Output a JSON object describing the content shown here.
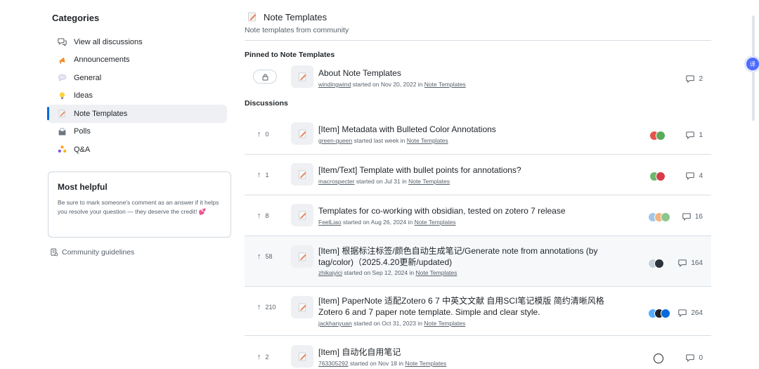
{
  "sidebar": {
    "heading": "Categories",
    "items": [
      {
        "label": "View all discussions",
        "icon": "discussions-icon"
      },
      {
        "label": "Announcements",
        "icon": "megaphone-icon"
      },
      {
        "label": "General",
        "icon": "speech-bubble-icon"
      },
      {
        "label": "Ideas",
        "icon": "lightbulb-icon"
      },
      {
        "label": "Note Templates",
        "icon": "memo-icon",
        "active": true
      },
      {
        "label": "Polls",
        "icon": "ballot-box-icon"
      },
      {
        "label": "Q&A",
        "icon": "people-icon"
      }
    ],
    "helpful": {
      "title": "Most helpful",
      "text": "Be sure to mark someone's comment as an answer if it helps you resolve your question — they deserve the credit! 💕"
    },
    "guidelines": "Community guidelines"
  },
  "header": {
    "title": "Note Templates",
    "subtitle": "Note templates from community"
  },
  "pinned_heading": "Pinned to Note Templates",
  "pinned": {
    "title": "About Note Templates",
    "author": "windingwind",
    "started": "started on Nov 20, 2022 in",
    "category": "Note Templates",
    "comments": "2"
  },
  "discussions_heading": "Discussions",
  "discussions": [
    {
      "votes": "0",
      "title": "[Item] Metadata with Bulleted Color Annotations",
      "author": "green-queen",
      "started": "started last week in",
      "category": "Note Templates",
      "comments": "1"
    },
    {
      "votes": "1",
      "title": "[Item/Text] Template with bullet points for annotations?",
      "author": "macrospecter",
      "started": "started on Jul 31 in",
      "category": "Note Templates",
      "comments": "4"
    },
    {
      "votes": "8",
      "title": "Templates for co-working with obsidian, tested on zotero 7 release",
      "author": "FeelLiao",
      "started": "started on Aug 26, 2024 in",
      "category": "Note Templates",
      "comments": "16"
    },
    {
      "votes": "58",
      "title": "[Item] 根据标注标签/颜色自动生成笔记/Generate note from annotations (by tag/color)（2025.4.20更新/updated)",
      "author": "zhikaiyici",
      "started": "started on Sep 12, 2024 in",
      "category": "Note Templates",
      "comments": "164"
    },
    {
      "votes": "210",
      "title": "[Item] PaperNote 适配Zotero 6 7 中英文文献 自用SCI笔记模版 简约清晰风格 Zotero 6 and 7 paper note template. Simple and clear style.",
      "author": "jackhanyuan",
      "started": "started on Oct 31, 2023 in",
      "category": "Note Templates",
      "comments": "264"
    },
    {
      "votes": "2",
      "title": "[Item] 自动化自用笔记",
      "author": "763305292",
      "started": "started on Nov 18 in",
      "category": "Note Templates",
      "comments": "0"
    }
  ],
  "colors": {
    "accent": "#0969da",
    "muted": "#57606a",
    "border": "#d8dee4",
    "active_bg": "#eef0f3",
    "float_button": "#4d6bfe"
  },
  "float_button_label": "译"
}
